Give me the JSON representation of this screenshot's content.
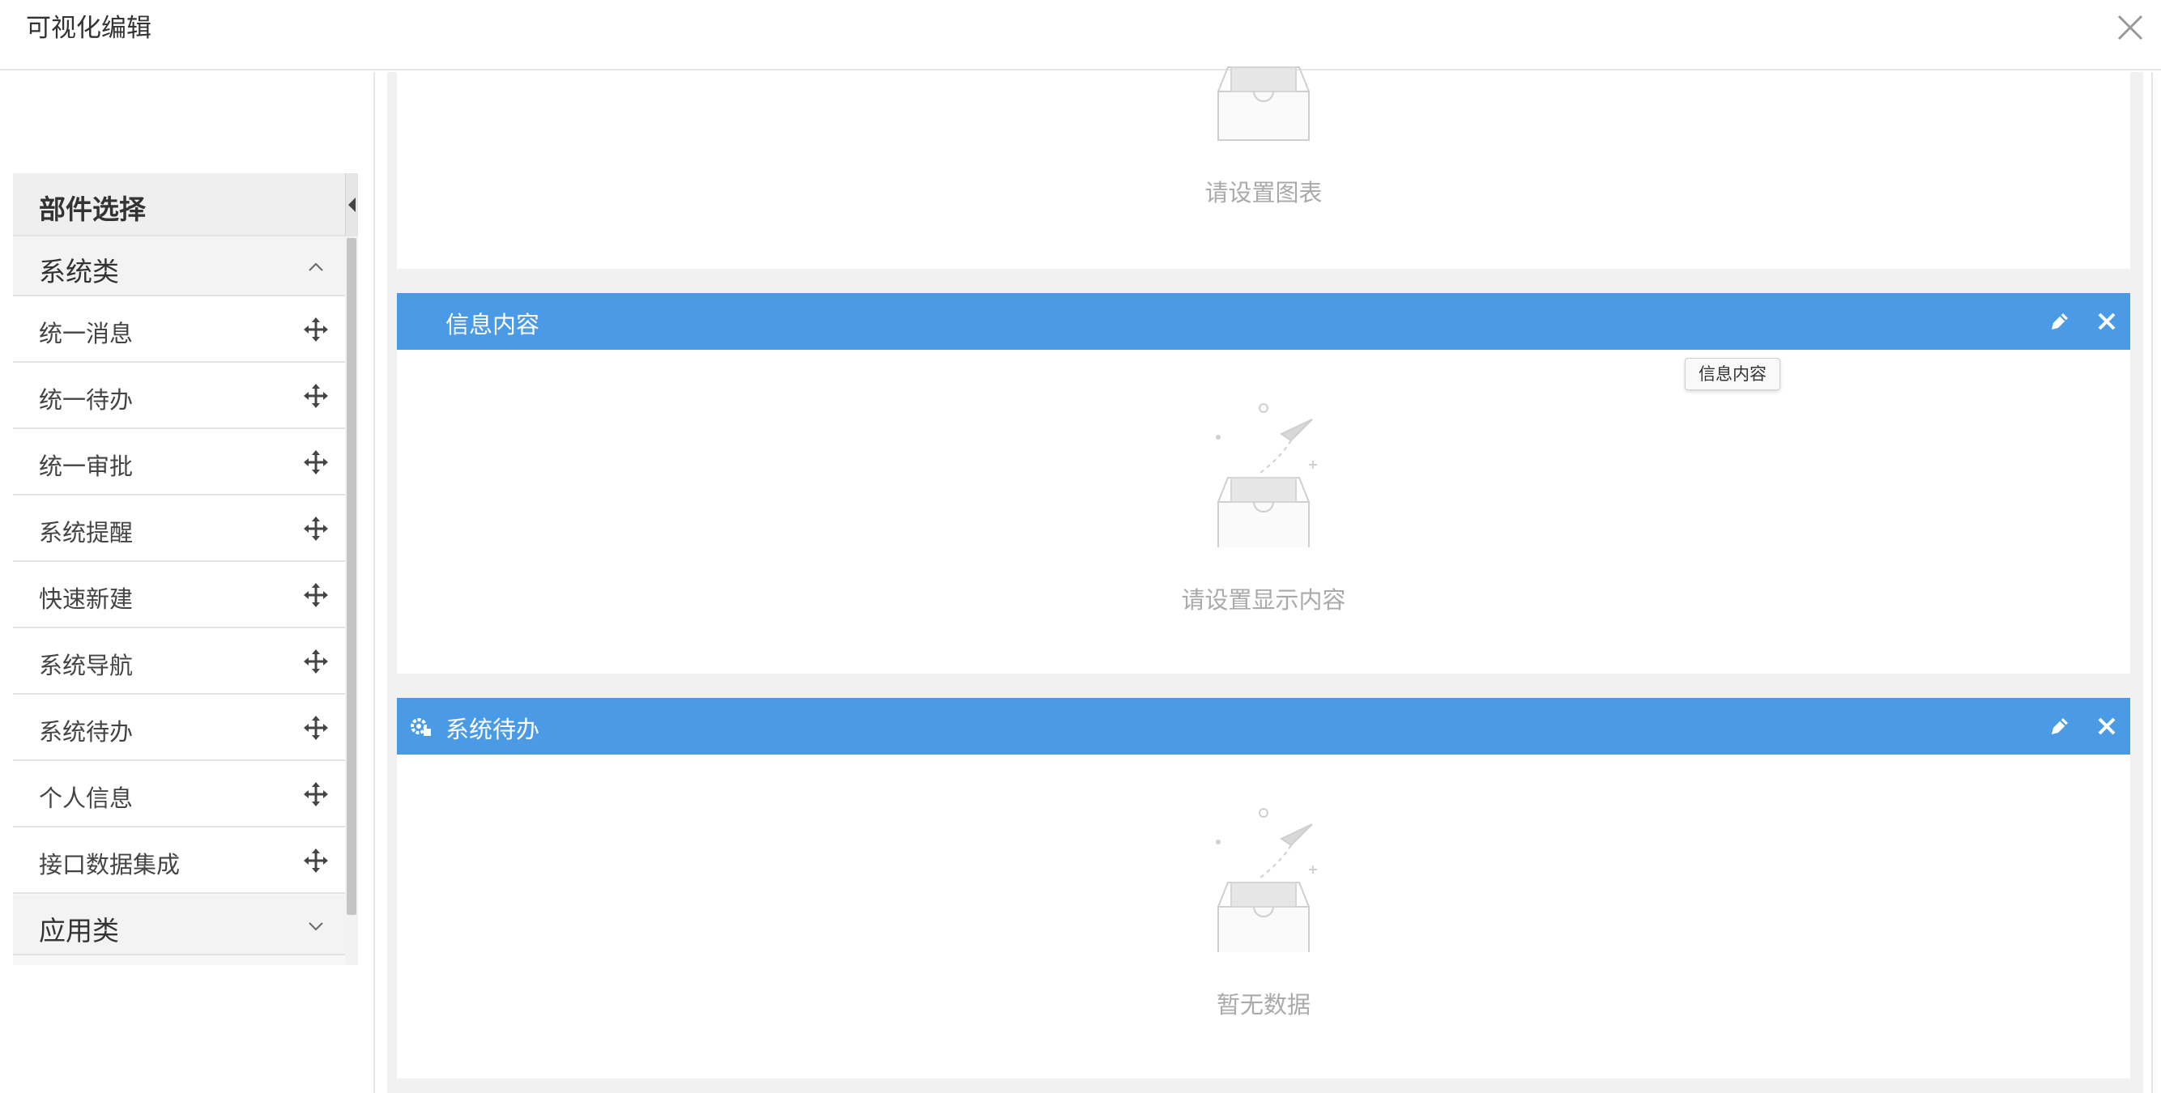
{
  "dialog": {
    "title": "可视化编辑"
  },
  "sidebar": {
    "panel_title": "部件选择",
    "groups": [
      {
        "label": "系统类",
        "expanded": true,
        "items": [
          "统一消息",
          "统一待办",
          "统一审批",
          "系统提醒",
          "快速新建",
          "系统导航",
          "系统待办",
          "个人信息",
          "接口数据集成"
        ]
      },
      {
        "label": "应用类",
        "expanded": false,
        "items": []
      }
    ]
  },
  "cards": [
    {
      "title": "",
      "empty_text": "请设置图表"
    },
    {
      "title": "信息内容",
      "empty_text": "请设置显示内容"
    },
    {
      "title": "系统待办",
      "empty_text": "暂无数据"
    }
  ],
  "tooltip": {
    "text": "信息内容"
  },
  "colors": {
    "accent": "#4a9ae6",
    "panel_bg": "#f7f7f7",
    "muted_text": "#aaaaaa"
  },
  "icons": [
    "close-icon",
    "collapse-arrow-icon",
    "chevron-up-icon",
    "chevron-down-icon",
    "move-icon",
    "gear-icon",
    "edit-icon",
    "delete-icon",
    "empty-box-icon"
  ]
}
